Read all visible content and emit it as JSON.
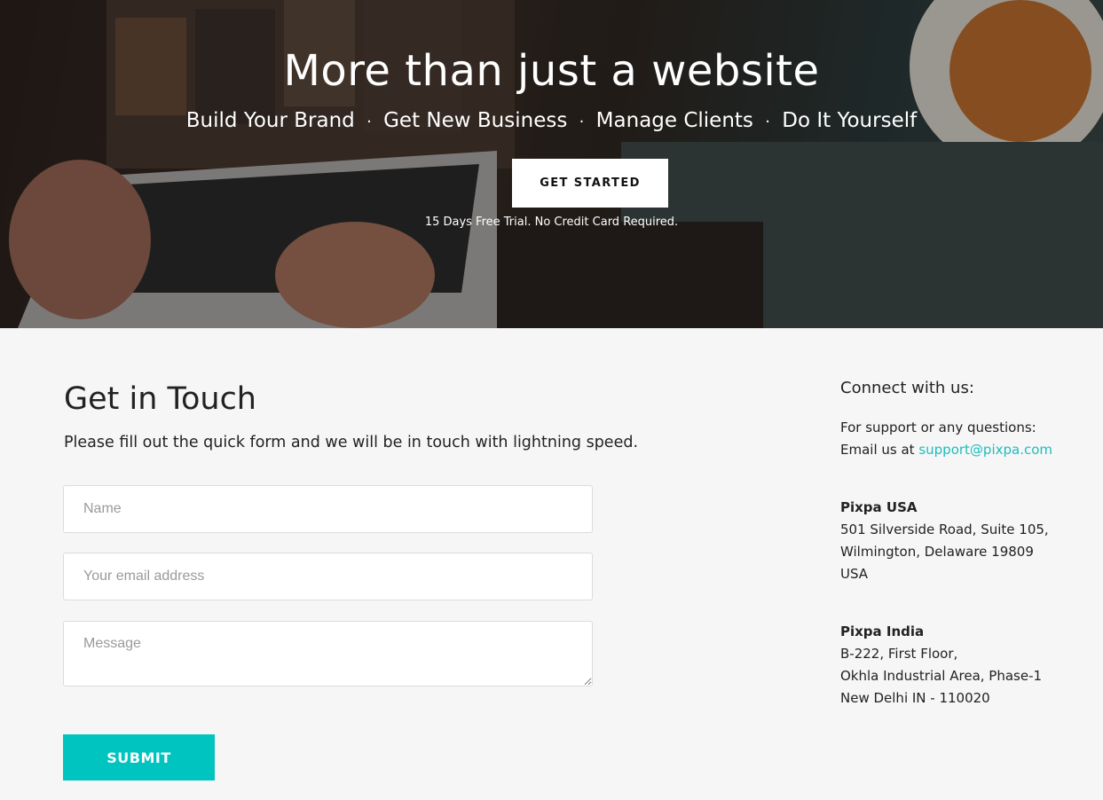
{
  "hero": {
    "title": "More than just a website",
    "taglines": [
      "Build Your Brand",
      "Get New Business",
      "Manage Clients",
      "Do It Yourself"
    ],
    "separator": "·",
    "cta_label": "GET STARTED",
    "note": "15 Days Free Trial. No Credit Card Required."
  },
  "contact": {
    "title": "Get in Touch",
    "subtitle": "Please fill out the quick form and we will be in touch with lightning speed.",
    "name_placeholder": "Name",
    "email_placeholder": "Your email address",
    "message_placeholder": "Message",
    "submit_label": "SUBMIT"
  },
  "connect": {
    "heading": "Connect with us:",
    "support_line": "For support or any questions:",
    "email_prefix": "Email us at",
    "email": "support@pixpa.com",
    "offices": [
      {
        "name": "Pixpa USA",
        "lines": [
          "501 Silverside Road, Suite 105,",
          "Wilmington, Delaware 19809",
          "USA"
        ]
      },
      {
        "name": "Pixpa India",
        "lines": [
          "B-222, First Floor,",
          "Okhla Industrial Area, Phase-1",
          "New Delhi IN - 110020"
        ]
      }
    ]
  },
  "colors": {
    "accent": "#00c4c0",
    "link": "#1dbdbd",
    "background": "#f6f6f6"
  }
}
